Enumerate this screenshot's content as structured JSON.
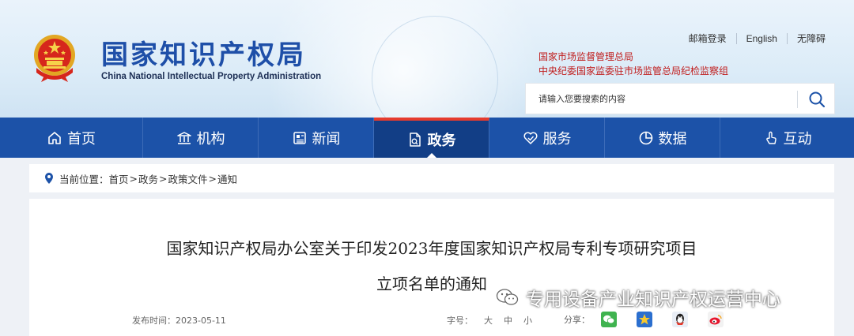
{
  "header": {
    "logo_cn": "国家知识产权局",
    "logo_en": "China National Intellectual Property Administration",
    "top_links": [
      {
        "label": "邮箱登录"
      },
      {
        "label": "English"
      },
      {
        "label": "无障碍"
      }
    ],
    "org_line1": "国家市场监督管理总局",
    "org_line2": "中央纪委国家监委驻市场监管总局纪检监察组",
    "search": {
      "placeholder": "请输入您要搜索的内容",
      "value": ""
    }
  },
  "nav": {
    "items": [
      {
        "label": "首页",
        "icon": "home-icon"
      },
      {
        "label": "机构",
        "icon": "institution-icon"
      },
      {
        "label": "新闻",
        "icon": "news-icon"
      },
      {
        "label": "政务",
        "icon": "government-icon",
        "active": true
      },
      {
        "label": "服务",
        "icon": "service-icon"
      },
      {
        "label": "数据",
        "icon": "data-chart-icon"
      },
      {
        "label": "互动",
        "icon": "interaction-icon"
      }
    ]
  },
  "breadcrumb": {
    "prefix": "当前位置：",
    "items": [
      "首页",
      "政务",
      "政策文件",
      "通知"
    ],
    "separator": ">"
  },
  "article": {
    "title_line1": "国家知识产权局办公室关于印发2023年度国家知识产权局专利专项研究项目",
    "title_line2": "立项名单的通知",
    "publish_label": "发布时间：",
    "publish_date": "2023-05-11",
    "font_size_label": "字号：",
    "font_sizes": [
      "大",
      "中",
      "小"
    ],
    "share_label": "分享：",
    "share_targets": [
      "wechat-icon",
      "qzone-icon",
      "qq-icon",
      "weibo-icon"
    ]
  },
  "watermark": {
    "text": "专用设备产业知识产权运营中心"
  },
  "colors": {
    "nav_bg": "#1c52a8",
    "nav_active": "#123e86",
    "accent_red": "#e53b2e",
    "logo_blue": "#1e4fa8",
    "org_red": "#c01c1c"
  }
}
